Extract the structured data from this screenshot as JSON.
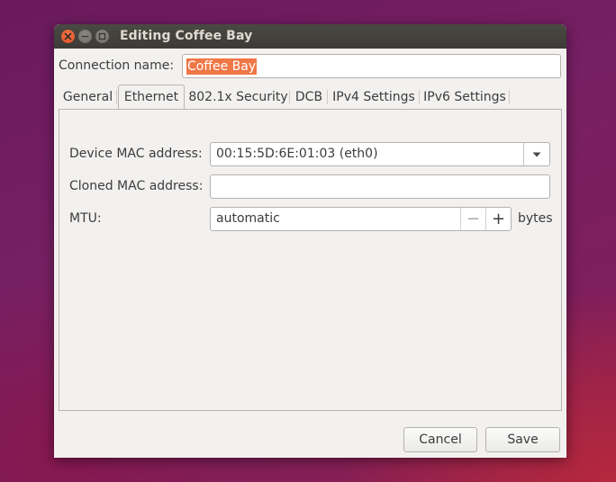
{
  "window": {
    "title": "Editing Coffee Bay",
    "controls": [
      "close-icon",
      "minimize-icon",
      "maximize-icon"
    ]
  },
  "connection": {
    "label": "Connection name:",
    "value": "Coffee Bay"
  },
  "tabs": [
    {
      "label": "General",
      "active": false
    },
    {
      "label": "Ethernet",
      "active": true
    },
    {
      "label": "802.1x Security",
      "active": false
    },
    {
      "label": "DCB",
      "active": false
    },
    {
      "label": "IPv4 Settings",
      "active": false
    },
    {
      "label": "IPv6 Settings",
      "active": false
    }
  ],
  "ethernet": {
    "device_mac_label": "Device MAC address:",
    "device_mac_value": "00:15:5D:6E:01:03 (eth0)",
    "cloned_mac_label": "Cloned MAC address:",
    "cloned_mac_value": "",
    "mtu_label": "MTU:",
    "mtu_value": "automatic",
    "mtu_unit": "bytes"
  },
  "buttons": {
    "cancel": "Cancel",
    "save": "Save"
  },
  "colors": {
    "selection": "#f07746",
    "titlebar": "#3c3b37",
    "close_button": "#df4b1f"
  }
}
